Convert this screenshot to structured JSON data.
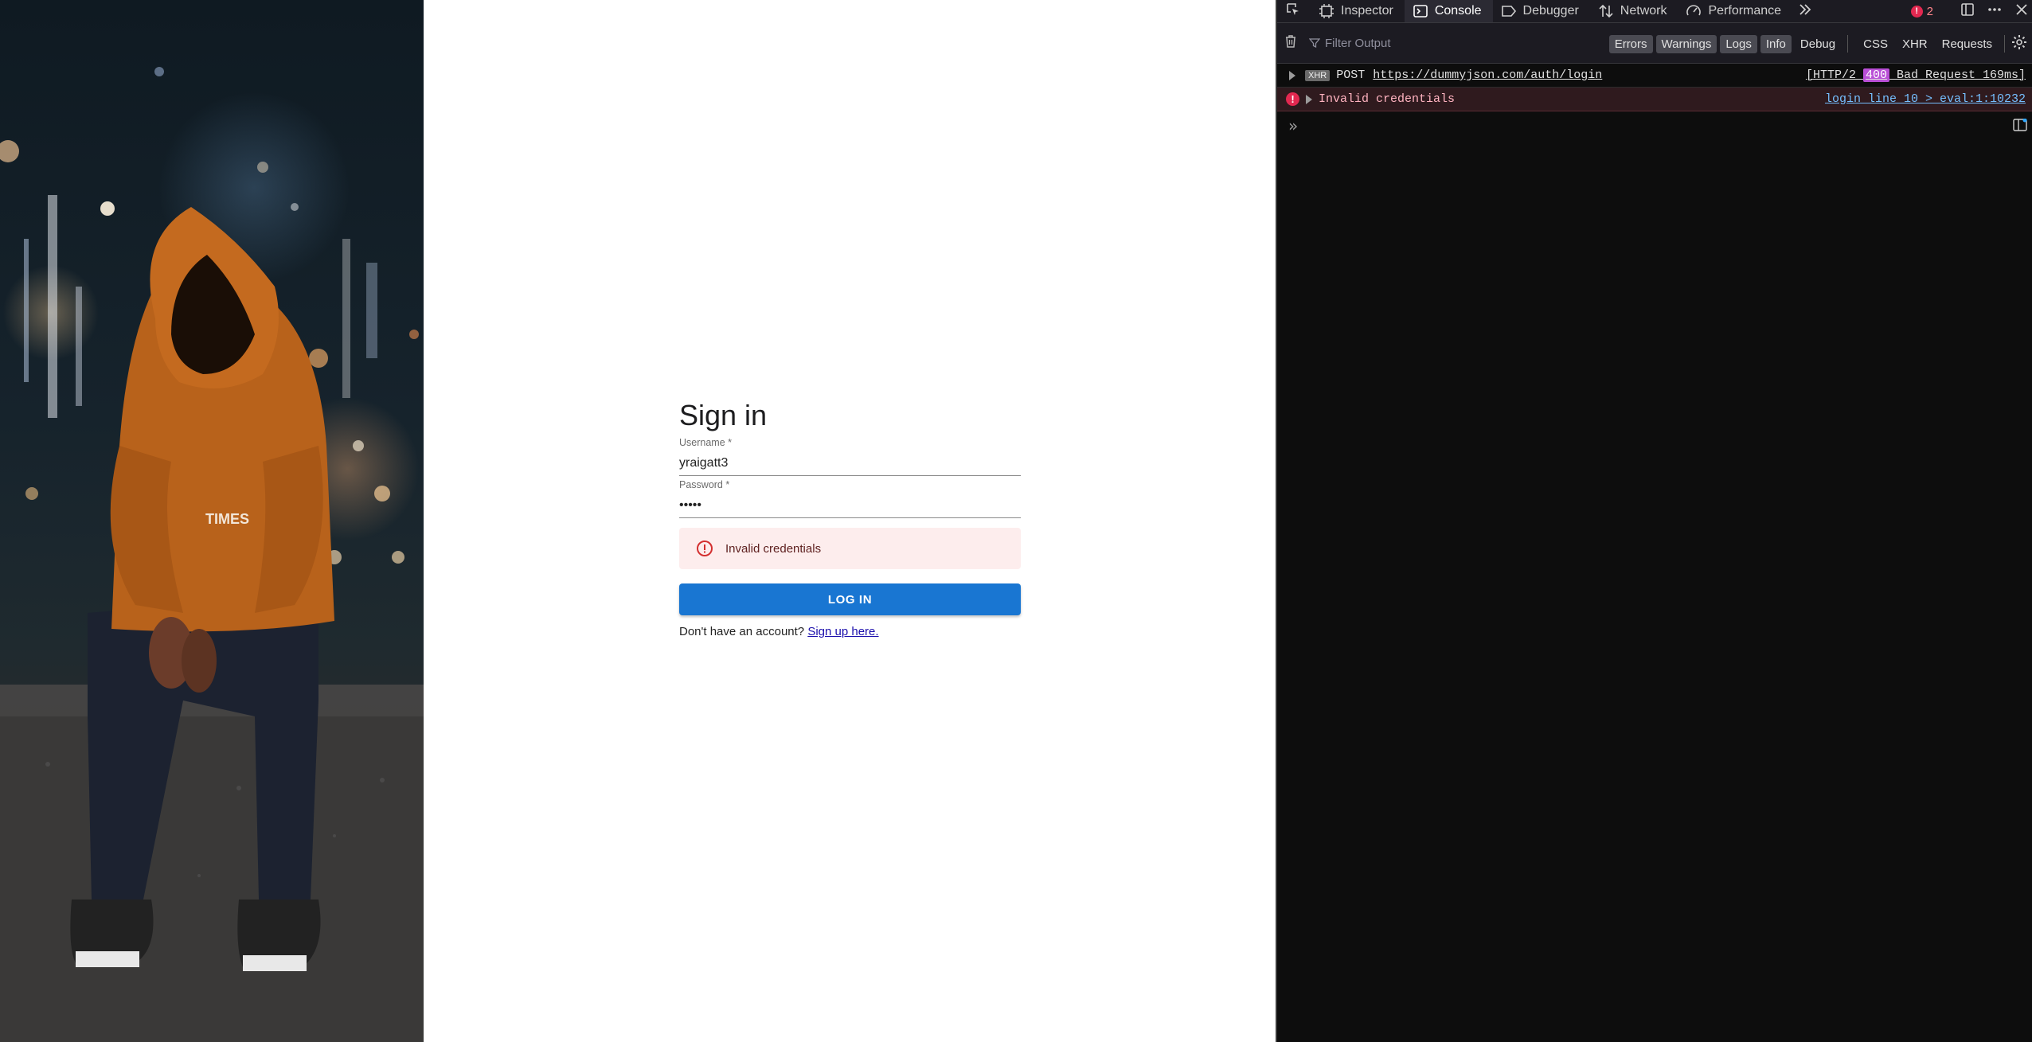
{
  "hero": {
    "hoodie_text": "TIMES"
  },
  "login": {
    "title": "Sign in",
    "username_label": "Username *",
    "username_value": "yraigatt3",
    "password_label": "Password *",
    "password_value": "•••••",
    "error_message": "Invalid credentials",
    "button_label": "LOG IN",
    "signup_prompt": "Don't have an account? ",
    "signup_link": "Sign up here."
  },
  "devtools": {
    "tabs": [
      {
        "label": "Inspector",
        "icon": "inspector-icon"
      },
      {
        "label": "Console",
        "icon": "console-icon",
        "active": true
      },
      {
        "label": "Debugger",
        "icon": "debugger-icon"
      },
      {
        "label": "Network",
        "icon": "network-icon"
      },
      {
        "label": "Performance",
        "icon": "performance-icon"
      }
    ],
    "error_count": "2",
    "filter_placeholder": "Filter Output",
    "filters": [
      {
        "label": "Errors",
        "on": true
      },
      {
        "label": "Warnings",
        "on": true
      },
      {
        "label": "Logs",
        "on": true
      },
      {
        "label": "Info",
        "on": true
      },
      {
        "label": "Debug",
        "on": false
      },
      {
        "label": "CSS",
        "on": false
      },
      {
        "label": "XHR",
        "on": false
      },
      {
        "label": "Requests",
        "on": false
      }
    ],
    "messages": {
      "xhr": {
        "badge": "XHR",
        "method": "POST",
        "url": "https://dummyjson.com/auth/login",
        "status_prefix": "[HTTP/2 ",
        "status_code": "400",
        "status_suffix": " Bad Request 169ms]"
      },
      "error": {
        "text": "Invalid credentials",
        "location": "login line 10 > eval:1:10232"
      }
    },
    "prompt_symbol": "»"
  },
  "colors": {
    "primary": "#1976d2",
    "error_bg": "#fdeded",
    "error_icon": "#d32f2f",
    "devtools_bg": "#0d0d0d",
    "devtools_error": "#e22850"
  }
}
